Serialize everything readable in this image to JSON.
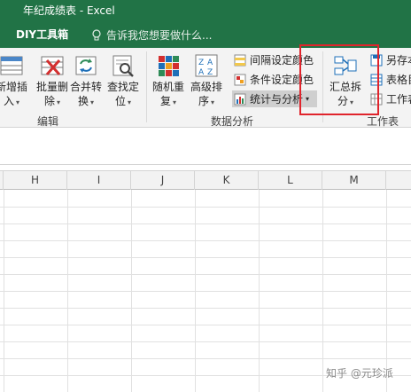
{
  "window": {
    "title": "年纪成绩表 - Excel"
  },
  "tabbar": {
    "active_tab": "DIY工具箱",
    "tell_me_placeholder": "告诉我您想要做什么..."
  },
  "ribbon": {
    "edit_group": {
      "label": "编辑",
      "buttons": [
        {
          "line1": "新增插",
          "line2": "入"
        },
        {
          "line1": "批量删",
          "line2": "除"
        },
        {
          "line1": "合并转",
          "line2": "换"
        },
        {
          "line1": "查找定",
          "line2": "位"
        }
      ]
    },
    "data_group": {
      "label": "数据分析",
      "buttons": [
        {
          "line1": "随机重",
          "line2": "复"
        },
        {
          "line1": "高级排",
          "line2": "序"
        }
      ],
      "small_items": [
        {
          "label": "间隔设定颜色"
        },
        {
          "label": "条件设定颜色"
        },
        {
          "label": "统计与分析"
        }
      ]
    },
    "sheet_group": {
      "label": "工作表",
      "summarize_button": {
        "line1": "汇总拆",
        "line2": "分"
      },
      "small_items": [
        {
          "label": "另存本"
        },
        {
          "label": "表格目"
        },
        {
          "label": "工作表"
        }
      ]
    }
  },
  "sheet": {
    "columns": [
      "H",
      "I",
      "J",
      "K",
      "L",
      "M"
    ]
  },
  "watermark": {
    "text": "知乎 @元珍派"
  },
  "colors": {
    "excel_green": "#217346",
    "highlight_red": "#e0242c"
  }
}
